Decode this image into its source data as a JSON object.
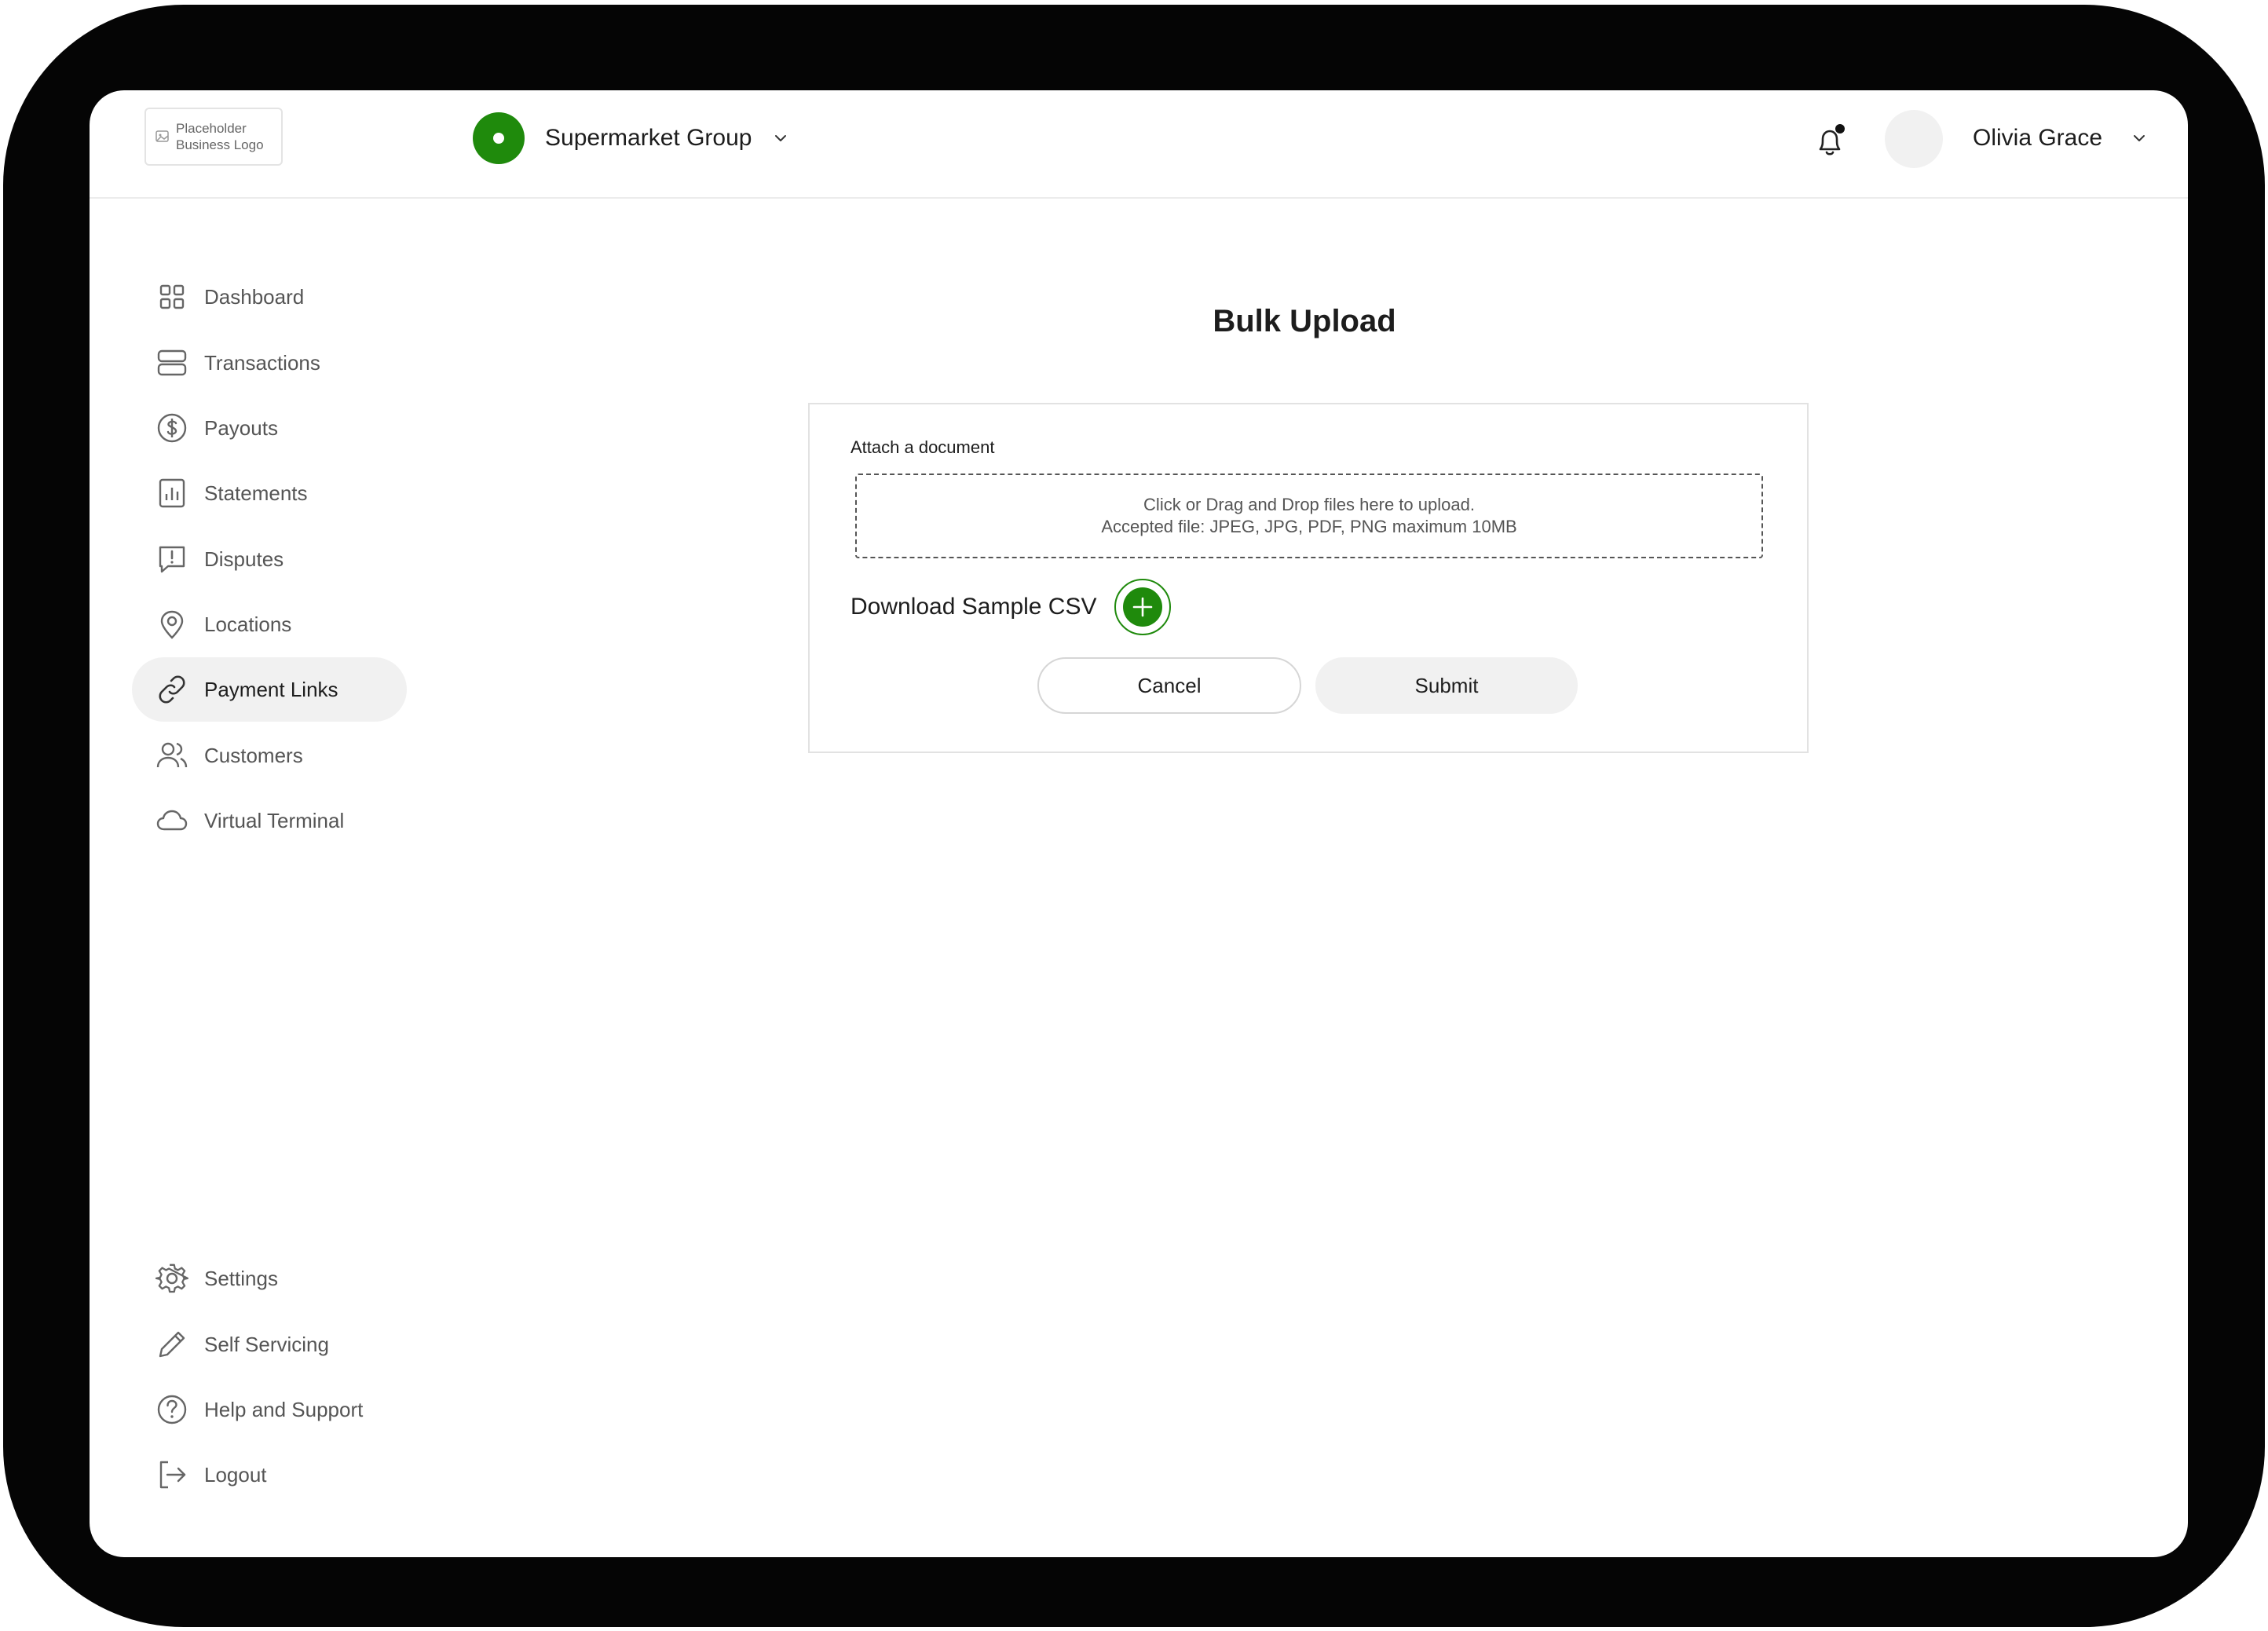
{
  "header": {
    "logo_text": "Placeholder\nBusiness Logo",
    "group_name": "Supermarket Group",
    "user_name": "Olivia Grace"
  },
  "sidebar": {
    "items": [
      {
        "label": "Dashboard",
        "icon": "dashboard-grid-icon"
      },
      {
        "label": "Transactions",
        "icon": "transactions-icon"
      },
      {
        "label": "Payouts",
        "icon": "dollar-circle-icon"
      },
      {
        "label": "Statements",
        "icon": "bar-chart-icon"
      },
      {
        "label": "Disputes",
        "icon": "alert-message-icon"
      },
      {
        "label": "Locations",
        "icon": "map-pin-icon"
      },
      {
        "label": "Payment Links",
        "icon": "link-icon",
        "active": true
      },
      {
        "label": "Customers",
        "icon": "users-icon"
      },
      {
        "label": "Virtual Terminal",
        "icon": "cloud-icon"
      }
    ],
    "bottom_items": [
      {
        "label": "Settings",
        "icon": "gear-icon"
      },
      {
        "label": "Self Servicing",
        "icon": "pencil-icon"
      },
      {
        "label": "Help and Support",
        "icon": "help-circle-icon"
      },
      {
        "label": "Logout",
        "icon": "logout-icon"
      }
    ]
  },
  "main": {
    "title": "Bulk Upload",
    "attach_label": "Attach a document",
    "dropzone_line1": "Click or Drag and Drop files here to upload.",
    "dropzone_line2": "Accepted file: JPEG, JPG, PDF, PNG maximum 10MB",
    "download_label": "Download Sample CSV",
    "cancel_label": "Cancel",
    "submit_label": "Submit"
  },
  "colors": {
    "accent": "#1f8a0c",
    "active_bg": "#f1f1f1",
    "device_frame": "#050505"
  }
}
